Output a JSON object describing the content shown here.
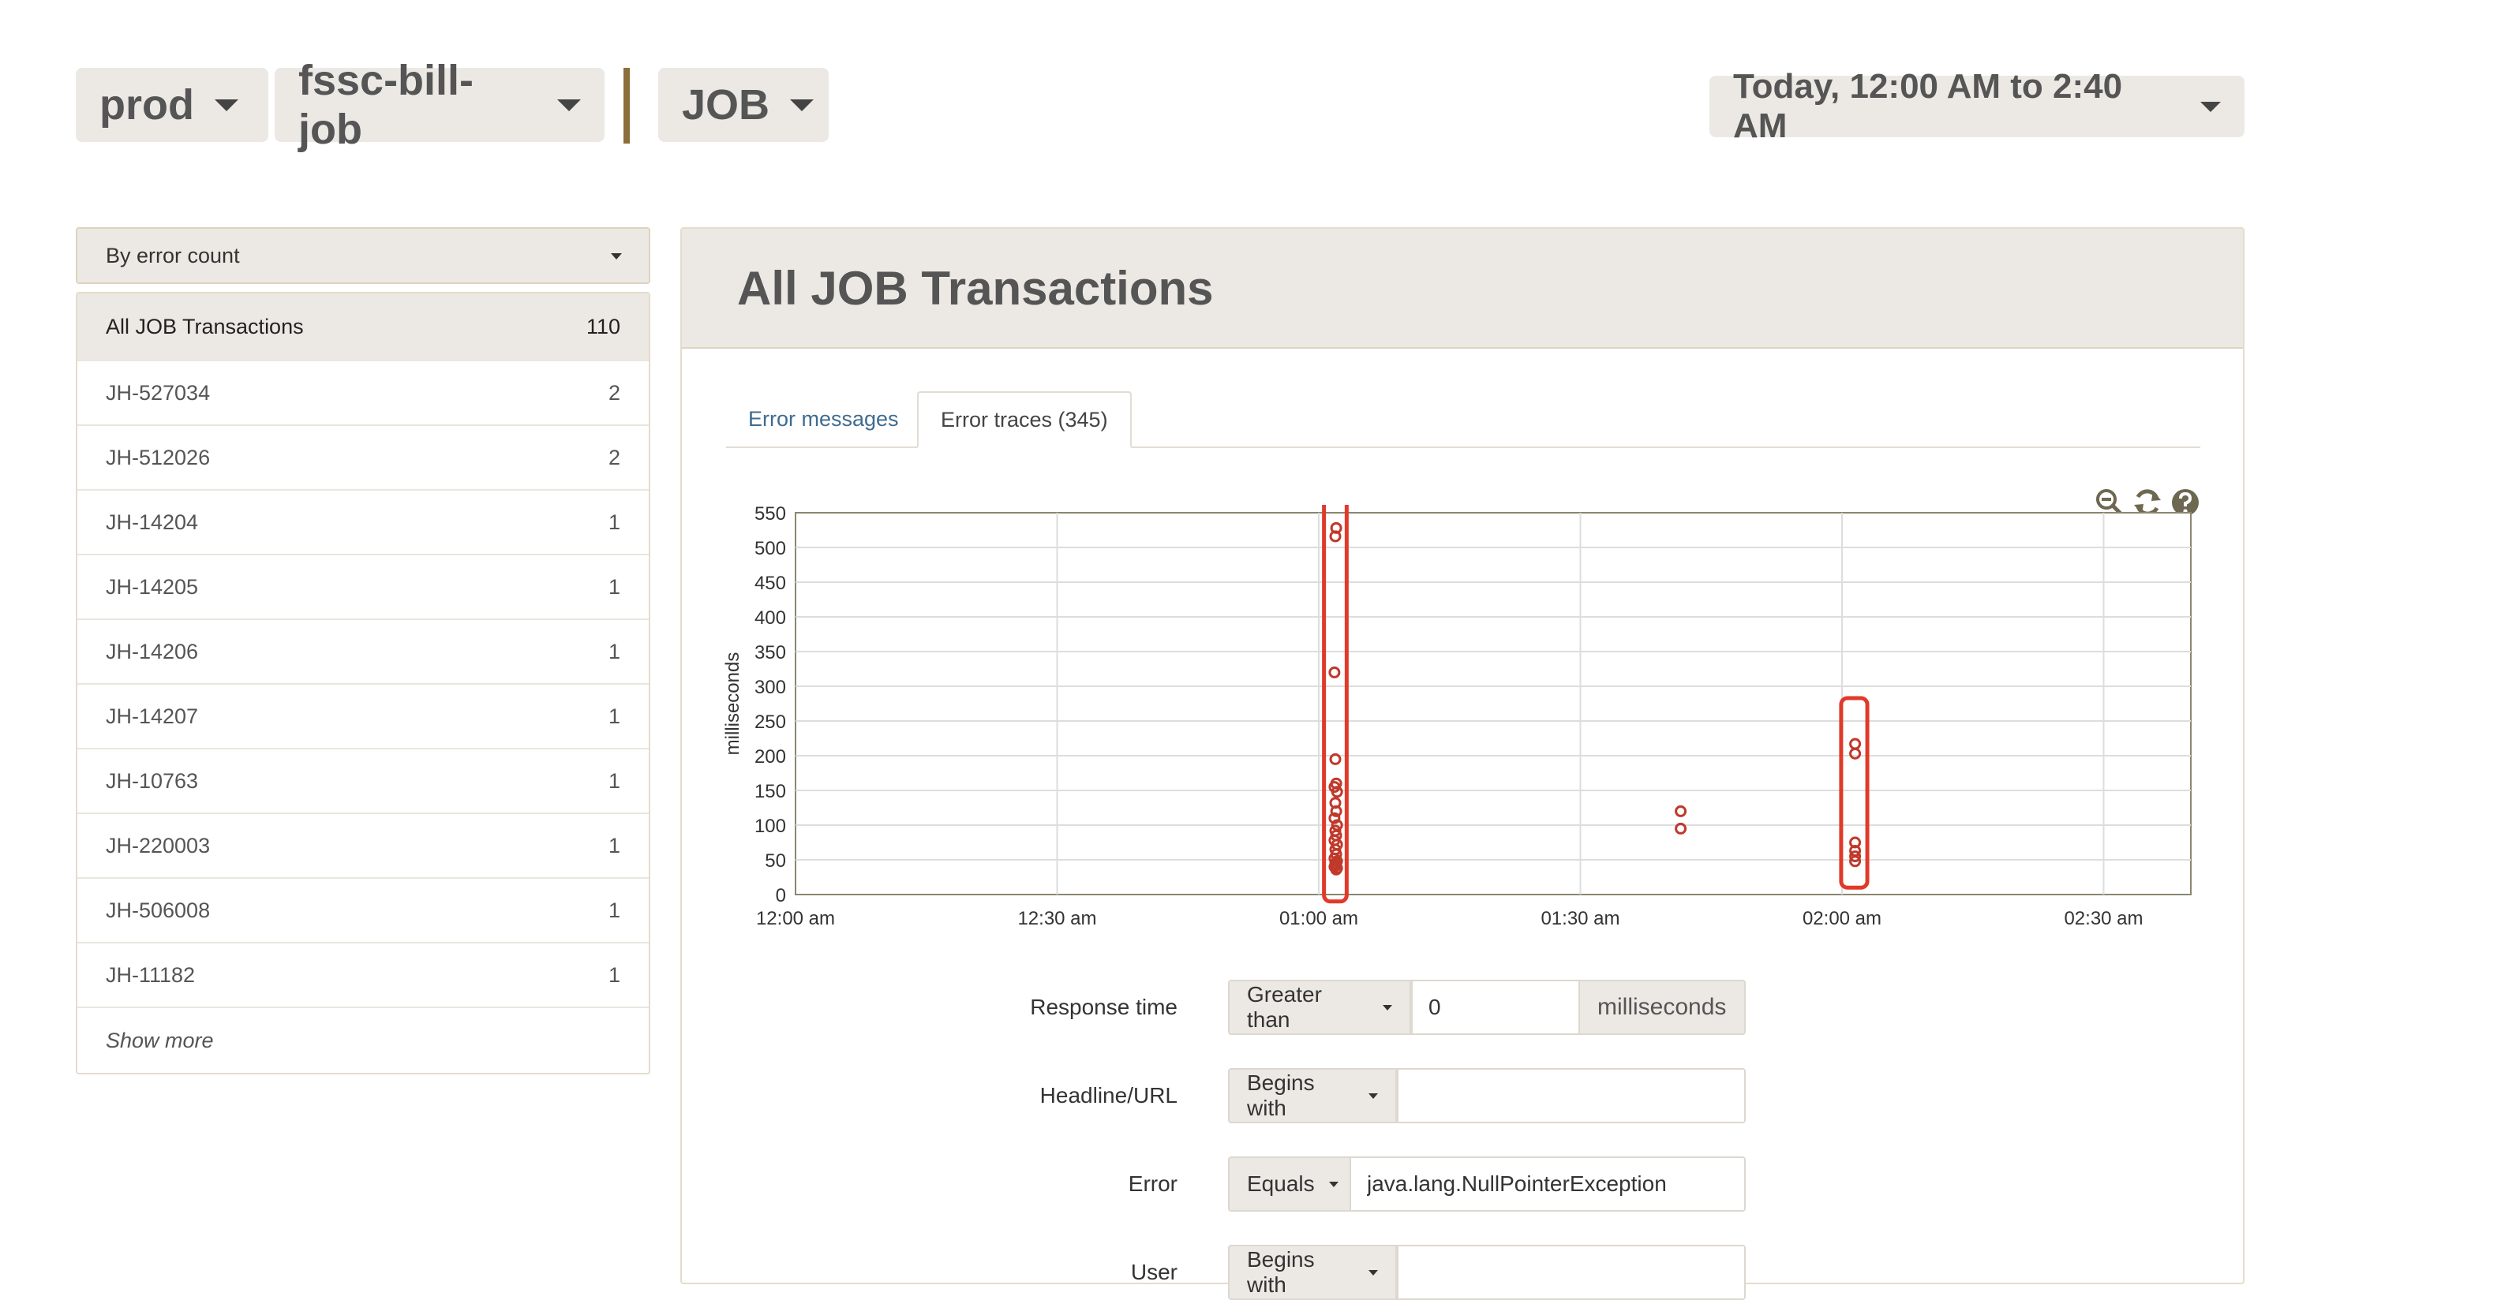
{
  "header": {
    "env": "prod",
    "app": "fssc-bill-job",
    "type": "JOB",
    "time_range": "Today, 12:00 AM to 2:40 AM"
  },
  "sidebar": {
    "sort_label": "By error count",
    "all": {
      "label": "All JOB Transactions",
      "count": "110"
    },
    "items": [
      {
        "label": "JH-527034",
        "count": "2"
      },
      {
        "label": "JH-512026",
        "count": "2"
      },
      {
        "label": "JH-14204",
        "count": "1"
      },
      {
        "label": "JH-14205",
        "count": "1"
      },
      {
        "label": "JH-14206",
        "count": "1"
      },
      {
        "label": "JH-14207",
        "count": "1"
      },
      {
        "label": "JH-10763",
        "count": "1"
      },
      {
        "label": "JH-220003",
        "count": "1"
      },
      {
        "label": "JH-506008",
        "count": "1"
      },
      {
        "label": "JH-11182",
        "count": "1"
      }
    ],
    "show_more": "Show more"
  },
  "main": {
    "title": "All JOB Transactions",
    "tabs": [
      {
        "label": "Error messages",
        "active": false
      },
      {
        "label": "Error traces (345)",
        "active": true
      }
    ],
    "icons": [
      "zoom-out-icon",
      "refresh-icon",
      "help-icon"
    ]
  },
  "filters": {
    "response_time": {
      "label": "Response time",
      "operator": "Greater than",
      "value": "0",
      "unit": "milliseconds"
    },
    "headline": {
      "label": "Headline/URL",
      "operator": "Begins with",
      "value": ""
    },
    "error": {
      "label": "Error",
      "operator": "Equals",
      "value": "java.lang.NullPointerException"
    },
    "user": {
      "label": "User",
      "operator": "Begins with",
      "value": ""
    }
  },
  "chart_data": {
    "type": "scatter",
    "ylabel": "milliseconds",
    "xlabel": "",
    "xlim": [
      0,
      160
    ],
    "ylim": [
      0,
      550
    ],
    "x_ticks": [
      {
        "v": 0,
        "label": "12:00 am"
      },
      {
        "v": 30,
        "label": "12:30 am"
      },
      {
        "v": 60,
        "label": "01:00 am"
      },
      {
        "v": 90,
        "label": "01:30 am"
      },
      {
        "v": 120,
        "label": "02:00 am"
      },
      {
        "v": 150,
        "label": "02:30 am"
      }
    ],
    "y_ticks": [
      0,
      50,
      100,
      150,
      200,
      250,
      300,
      350,
      400,
      450,
      500,
      550
    ],
    "grid": true,
    "point_color": "#c0392b",
    "highlight_color": "#e03a2a",
    "points": [
      [
        62,
        528
      ],
      [
        61.9,
        516
      ],
      [
        61.8,
        320
      ],
      [
        61.9,
        195
      ],
      [
        62,
        160
      ],
      [
        61.8,
        155
      ],
      [
        62.1,
        148
      ],
      [
        61.9,
        132
      ],
      [
        62,
        120
      ],
      [
        61.8,
        110
      ],
      [
        62.1,
        100
      ],
      [
        61.9,
        92
      ],
      [
        62,
        85
      ],
      [
        61.8,
        78
      ],
      [
        62.1,
        72
      ],
      [
        61.9,
        65
      ],
      [
        62,
        58
      ],
      [
        61.8,
        52
      ],
      [
        62.1,
        48
      ],
      [
        61.9,
        45
      ],
      [
        62,
        42
      ],
      [
        61.8,
        40
      ],
      [
        62.1,
        38
      ],
      [
        62,
        36
      ],
      [
        101.5,
        120
      ],
      [
        101.5,
        95
      ],
      [
        121.5,
        217
      ],
      [
        121.5,
        203
      ],
      [
        121.5,
        75
      ],
      [
        121.5,
        63
      ],
      [
        121.5,
        55
      ],
      [
        121.5,
        48
      ]
    ],
    "highlights": [
      {
        "x": [
          60.6,
          63.2
        ],
        "y": [
          -10,
          570
        ]
      },
      {
        "x": [
          119.9,
          122.9
        ],
        "y": [
          10,
          283
        ]
      }
    ]
  }
}
